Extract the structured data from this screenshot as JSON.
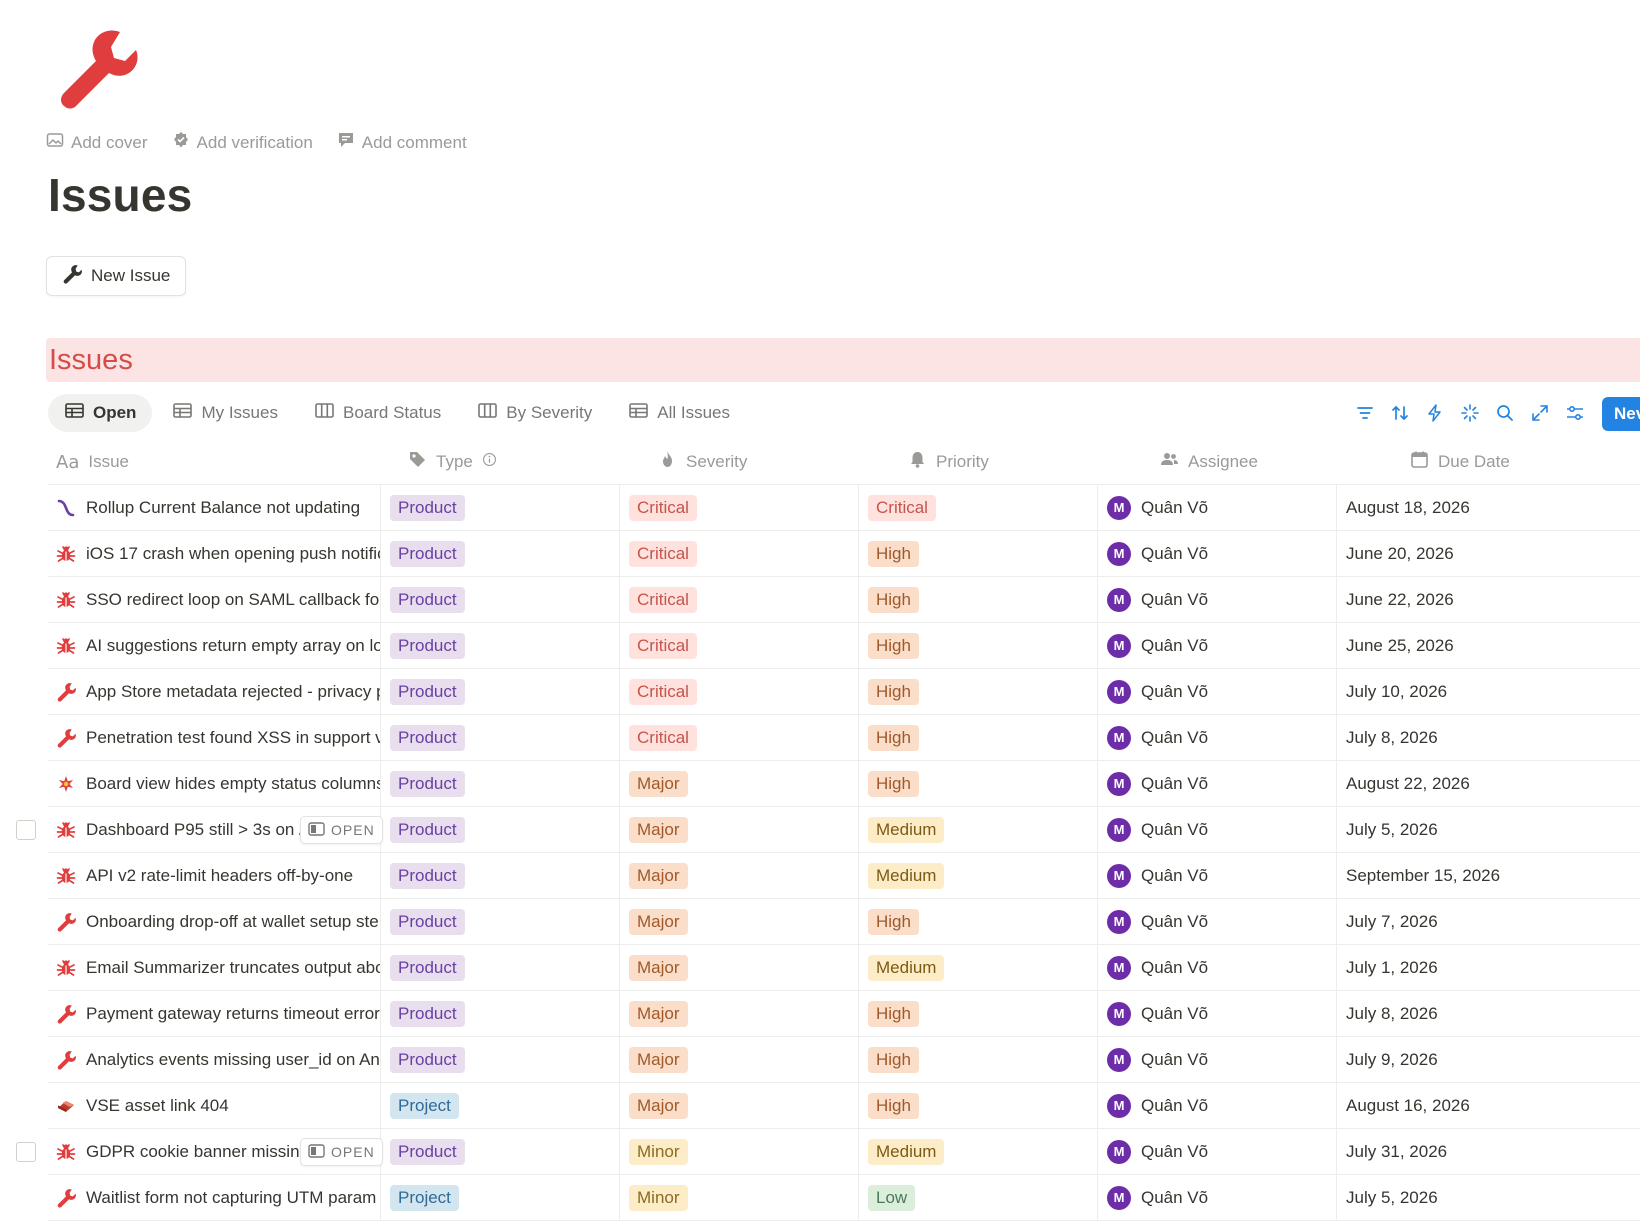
{
  "page": {
    "icon": "wrench-icon",
    "actions": [
      {
        "label": "Add cover",
        "icon": "image-icon"
      },
      {
        "label": "Add verification",
        "icon": "verified-badge-icon"
      },
      {
        "label": "Add comment",
        "icon": "comment-icon"
      }
    ],
    "title": "Issues",
    "new_issue_label": "New Issue"
  },
  "database": {
    "title": "Issues",
    "views": [
      {
        "label": "Open",
        "icon": "table-icon",
        "active": true
      },
      {
        "label": "My Issues",
        "icon": "table-icon",
        "active": false
      },
      {
        "label": "Board Status",
        "icon": "board-icon",
        "active": false
      },
      {
        "label": "By Severity",
        "icon": "board-icon",
        "active": false
      },
      {
        "label": "All Issues",
        "icon": "table-icon",
        "active": false
      }
    ],
    "toolbar": [
      "filter-icon",
      "sort-icon",
      "automation-icon",
      "ai-sparkle-icon",
      "search-icon",
      "expand-icon",
      "settings-icon"
    ],
    "new_button_label": "Nev",
    "columns": {
      "issue": "Issue",
      "type": "Type",
      "severity": "Severity",
      "priority": "Priority",
      "assignee": "Assignee",
      "due": "Due Date"
    },
    "open_chip_label": "OPEN",
    "rows": [
      {
        "icon": "formula-icon",
        "name": "Rollup Current Balance not updating",
        "type": "Product",
        "severity": "Critical",
        "priority": "Critical",
        "assignee": "Quân Võ",
        "avatar": "M",
        "due": "August 18, 2026"
      },
      {
        "icon": "bug-icon",
        "name": "iOS 17 crash when opening push notific",
        "type": "Product",
        "severity": "Critical",
        "priority": "High",
        "assignee": "Quân Võ",
        "avatar": "M",
        "due": "June 20, 2026"
      },
      {
        "icon": "bug-icon",
        "name": "SSO redirect loop on SAML callback for",
        "type": "Product",
        "severity": "Critical",
        "priority": "High",
        "assignee": "Quân Võ",
        "avatar": "M",
        "due": "June 22, 2026"
      },
      {
        "icon": "bug-icon",
        "name": "AI suggestions return empty array on lo",
        "type": "Product",
        "severity": "Critical",
        "priority": "High",
        "assignee": "Quân Võ",
        "avatar": "M",
        "due": "June 25, 2026"
      },
      {
        "icon": "wrench-icon",
        "name": "App Store metadata rejected - privacy p",
        "type": "Product",
        "severity": "Critical",
        "priority": "High",
        "assignee": "Quân Võ",
        "avatar": "M",
        "due": "July 10, 2026"
      },
      {
        "icon": "wrench-icon",
        "name": "Penetration test found XSS in support v",
        "type": "Product",
        "severity": "Critical",
        "priority": "High",
        "assignee": "Quân Võ",
        "avatar": "M",
        "due": "July 8, 2026"
      },
      {
        "icon": "sparkle-icon",
        "name": "Board view hides empty status columns",
        "type": "Product",
        "severity": "Major",
        "priority": "High",
        "assignee": "Quân Võ",
        "avatar": "M",
        "due": "August 22, 2026"
      },
      {
        "icon": "bug-icon",
        "name": "Dashboard P95 still > 3s on /",
        "type": "Product",
        "severity": "Major",
        "priority": "Medium",
        "assignee": "Quân Võ",
        "avatar": "M",
        "due": "July 5, 2026",
        "hover": true
      },
      {
        "icon": "bug-icon",
        "name": "API v2 rate-limit headers off-by-one",
        "type": "Product",
        "severity": "Major",
        "priority": "Medium",
        "assignee": "Quân Võ",
        "avatar": "M",
        "due": "September 15, 2026"
      },
      {
        "icon": "wrench-icon",
        "name": "Onboarding drop-off at wallet setup ste",
        "type": "Product",
        "severity": "Major",
        "priority": "High",
        "assignee": "Quân Võ",
        "avatar": "M",
        "due": "July 7, 2026"
      },
      {
        "icon": "bug-icon",
        "name": "Email Summarizer truncates output abo",
        "type": "Product",
        "severity": "Major",
        "priority": "Medium",
        "assignee": "Quân Võ",
        "avatar": "M",
        "due": "July 1, 2026"
      },
      {
        "icon": "wrench-icon",
        "name": "Payment gateway returns timeout error",
        "type": "Product",
        "severity": "Major",
        "priority": "High",
        "assignee": "Quân Võ",
        "avatar": "M",
        "due": "July 8, 2026"
      },
      {
        "icon": "wrench-icon",
        "name": "Analytics events missing user_id on And",
        "type": "Product",
        "severity": "Major",
        "priority": "High",
        "assignee": "Quân Võ",
        "avatar": "M",
        "due": "July 9, 2026"
      },
      {
        "icon": "eraser-icon",
        "name": "VSE asset link 404",
        "type": "Project",
        "severity": "Major",
        "priority": "High",
        "assignee": "Quân Võ",
        "avatar": "M",
        "due": "August 16, 2026"
      },
      {
        "icon": "bug-icon",
        "name": "GDPR cookie banner missing",
        "type": "Product",
        "severity": "Minor",
        "priority": "Medium",
        "assignee": "Quân Võ",
        "avatar": "M",
        "due": "July 31, 2026",
        "hover": true
      },
      {
        "icon": "wrench-icon",
        "name": "Waitlist form not capturing UTM param",
        "type": "Project",
        "severity": "Minor",
        "priority": "Low",
        "assignee": "Quân Võ",
        "avatar": "M",
        "due": "July 5, 2026"
      }
    ]
  },
  "colors": {
    "Product": {
      "bg": "#e8deee",
      "fg": "#6940a5"
    },
    "Project": {
      "bg": "#d3e5ef",
      "fg": "#2f6a99"
    },
    "Critical": {
      "bg": "#ffe2dd",
      "fg": "#c4554d"
    },
    "Major": {
      "bg": "#fadec9",
      "fg": "#a0592a"
    },
    "Minor": {
      "bg": "#fdecc8",
      "fg": "#8a6b1f"
    },
    "High": {
      "bg": "#fadec9",
      "fg": "#a0592a"
    },
    "Medium": {
      "bg": "#fdecc8",
      "fg": "#7d5a12"
    },
    "Low": {
      "bg": "#dbeddb",
      "fg": "#4b7a58"
    }
  }
}
